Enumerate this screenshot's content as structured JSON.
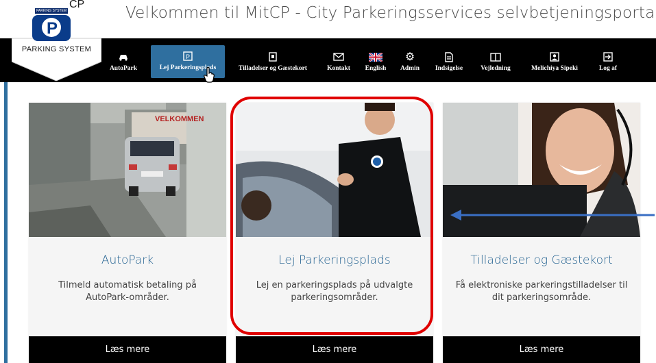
{
  "header": {
    "title": "Velkommen til MitCP - City Parkeringsservices selvbetjeningsportal",
    "logo": {
      "small_label": "PARKING SYSTEM",
      "cp": "CP",
      "label": "PARKING SYSTEM"
    }
  },
  "nav": {
    "items": [
      {
        "label": "AutoPark",
        "icon": "car-icon"
      },
      {
        "label": "Lej Parkeringsplads",
        "icon": "parking-icon",
        "active": true
      },
      {
        "label": "Tilladelser og Gæstekort",
        "icon": "permit-icon"
      },
      {
        "label": "Kontakt",
        "icon": "envelope-icon"
      },
      {
        "label": "English",
        "icon": "uk-flag-icon"
      },
      {
        "label": "Admin",
        "icon": "gear-icon"
      },
      {
        "label": "Indsigelse",
        "icon": "document-icon"
      },
      {
        "label": "Vejledning",
        "icon": "book-icon"
      },
      {
        "label": "Melichiya Sipeki",
        "icon": "user-icon"
      },
      {
        "label": "Log af",
        "icon": "logout-icon"
      }
    ]
  },
  "cards": [
    {
      "title": "AutoPark",
      "desc": "Tilmeld automatisk betaling på AutoPark-områder.",
      "button": "Læs mere"
    },
    {
      "title": "Lej Parkeringsplads",
      "desc": "Lej en parkeringsplads på udvalgte parkeringsområder.",
      "button": "Læs mere"
    },
    {
      "title": "Tilladelser og Gæstekort",
      "desc": "Få elektroniske parkeringstilladelser til dit parkeringsområde.",
      "button": "Læs mere"
    }
  ],
  "photo1_sign": "VELKOMMEN",
  "colors": {
    "accent": "#2f6f9f",
    "navbar": "#000000",
    "highlight": "#e00000",
    "title": "#1f5f8f"
  }
}
